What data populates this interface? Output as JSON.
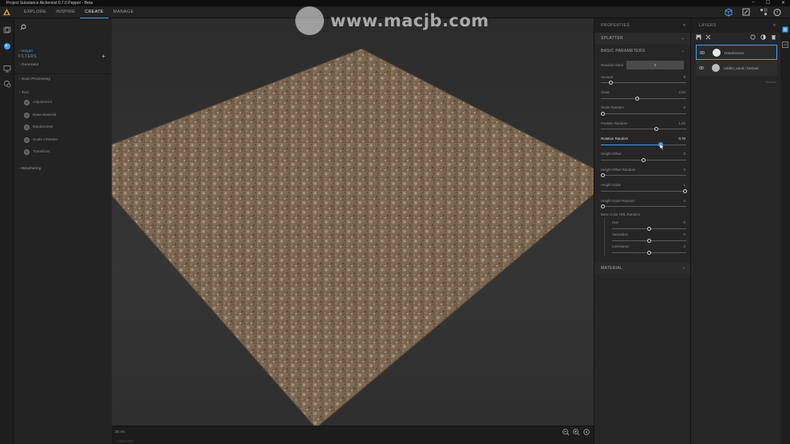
{
  "window": {
    "title": "Project Substance Alchemist 0.7.0 Pepper - Beta",
    "controls": [
      "–",
      "☐",
      "✕"
    ]
  },
  "nav": {
    "tabs": [
      {
        "label": "EXPLORE"
      },
      {
        "label": "INSPIRE"
      },
      {
        "label": "CREATE"
      },
      {
        "label": "MANAGE"
      }
    ]
  },
  "watermark": {
    "text": "www.macjb.com"
  },
  "filters": {
    "header": "FILTERS",
    "sections": [
      {
        "label": "› Height"
      },
      {
        "label": "› Generator"
      },
      {
        "label": "› Scan Processing"
      },
      {
        "label": "› Tool"
      },
      {
        "label": "› Weathering"
      }
    ],
    "tool_items": [
      "Adjustment",
      "Base Material",
      "Randomizer",
      "Scale Checker",
      "Transform"
    ]
  },
  "viewport": {
    "fps": "30 ms",
    "library": "LIBRARY"
  },
  "properties": {
    "title": "PROPERTIES",
    "close": "✕",
    "splatter": "SPLATTER",
    "basic": "BASIC PARAMETERS",
    "seed_label": "Random Seed",
    "seed_value": "0",
    "params": [
      {
        "label": "Amount",
        "value": "8"
      },
      {
        "label": "Scale",
        "value": "2.94"
      },
      {
        "label": "Scale Random",
        "value": "0"
      },
      {
        "label": "Position Random",
        "value": "1.02"
      },
      {
        "label": "Rotation Random",
        "value": "0.70"
      },
      {
        "label": "Height Offset",
        "value": "0"
      },
      {
        "label": "Height Offset Random",
        "value": "0"
      },
      {
        "label": "Height Scale",
        "value": "1"
      },
      {
        "label": "Height Scale Random",
        "value": "0"
      }
    ],
    "hsl_title": "Base Color HSL Random",
    "hsl": [
      {
        "label": "Hue",
        "value": "0"
      },
      {
        "label": "Saturation",
        "value": "0"
      },
      {
        "label": "Luminance",
        "value": "0"
      }
    ],
    "material": "MATERIAL"
  },
  "layers": {
    "title": "LAYERS",
    "close": "✕",
    "items": [
      {
        "label": "Randomizer"
      },
      {
        "label": "rubble_sand / Default"
      }
    ],
    "footer": "Reload"
  },
  "colors": {
    "accent": "#3aa0ff"
  }
}
